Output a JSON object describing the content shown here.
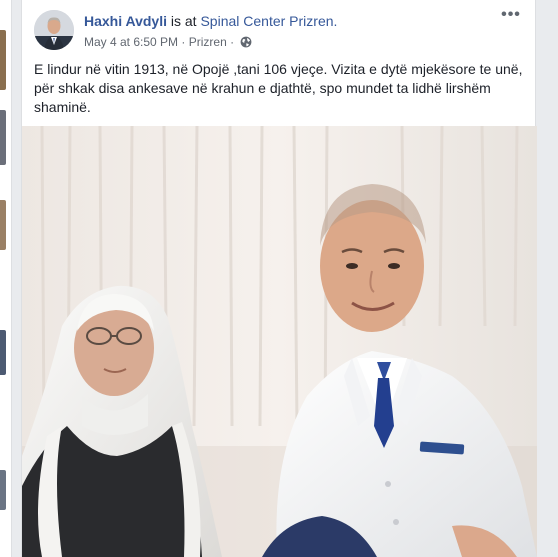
{
  "post": {
    "author": "Haxhi Avdyli",
    "connector": "is at",
    "place": "Spinal Center Prizren.",
    "date": "May 4 at 6:50 PM",
    "separator": "·",
    "location": "Prizren",
    "separator2": "·",
    "privacy_icon": "globe-icon",
    "more_icon": "more-options-icon",
    "more_label": "•••",
    "text": "E lindur në vitin 1913, në Opojë ,tani 106 vjeçe. Vizita e dytë mjekësore te unë, për shkak disa ankesave në krahun e djathtë, spo mundet ta lidhë lirshëm shaminë.",
    "photo": "photo-doctor-and-elderly-patient"
  },
  "colors": {
    "link": "#365899",
    "text": "#1d2129",
    "meta": "#616770",
    "background": "#e9ebee",
    "card": "#ffffff"
  }
}
